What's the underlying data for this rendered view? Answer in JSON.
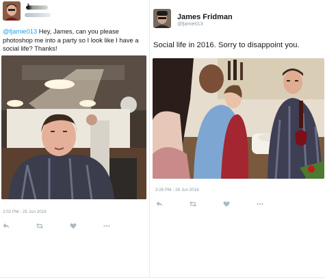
{
  "colors": {
    "link": "#1da1f2",
    "meta": "#8899a6",
    "icon": "#aab8c2"
  },
  "left_tweet": {
    "author_name_blurred": "J",
    "mention": "@fjamie013",
    "text": " Hey, James, can you please photoshop me into a party so I look like I have a social life? Thanks!",
    "timestamp": "2:02 PM - 25 Jun 2016",
    "icons": [
      "reply-icon",
      "retweet-icon",
      "like-icon",
      "more-icon"
    ]
  },
  "right_tweet": {
    "author_name": "James Fridman",
    "author_handle": "@fjamie013",
    "text": "Social life in 2016. Sorry to disappoint you.",
    "timestamp": "3:26 PM - 28 Jun 2016",
    "icons": [
      "reply-icon",
      "retweet-icon",
      "like-icon",
      "more-icon"
    ]
  }
}
